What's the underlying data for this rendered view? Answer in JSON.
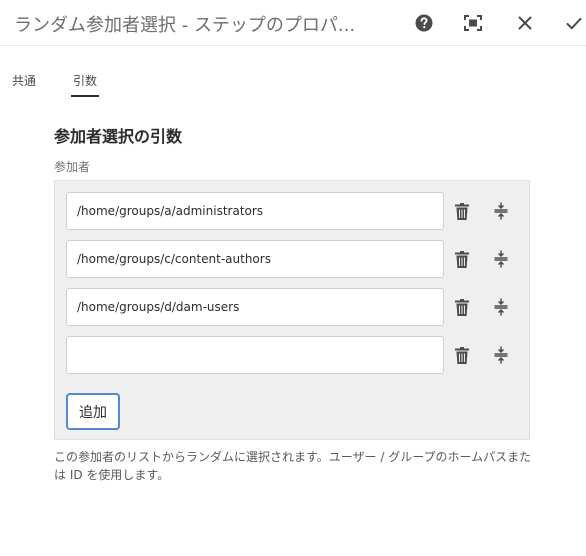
{
  "header": {
    "title": "ランダム参加者選択 - ステップのプロパ..."
  },
  "tabs": [
    {
      "label": "共通",
      "active": false
    },
    {
      "label": "引数",
      "active": true
    }
  ],
  "section": {
    "title": "参加者選択の引数",
    "field_label": "参加者",
    "participants": [
      "/home/groups/a/administrators",
      "/home/groups/c/content-authors",
      "/home/groups/d/dam-users",
      ""
    ],
    "add_label": "追加",
    "help_text": "この参加者のリストからランダムに選択されます。ユーザー / グループのホームパスまたは ID を使用します。"
  },
  "icons": {
    "help": "help-icon",
    "fullscreen": "fullscreen-icon",
    "close": "close-icon",
    "confirm": "checkmark-icon",
    "delete": "trash-icon",
    "reorder": "move-handle-icon"
  },
  "colors": {
    "accent": "#4f8ad6",
    "panel": "#efefef"
  }
}
